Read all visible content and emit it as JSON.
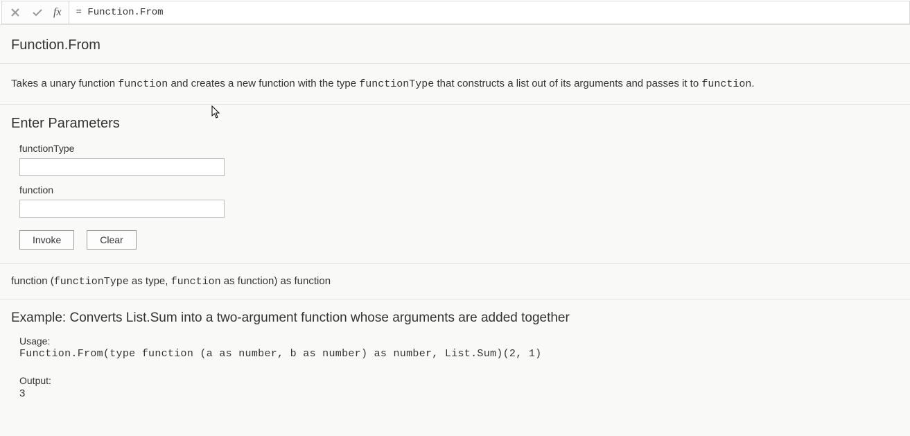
{
  "formulaBar": {
    "fxLabel": "fx",
    "formula": "= Function.From"
  },
  "doc": {
    "title": "Function.From",
    "description_pre": "Takes a unary function ",
    "description_code1": "function",
    "description_mid": " and creates a new function with the type ",
    "description_code2": "functionType",
    "description_post": " that constructs a list out of its arguments and passes it to ",
    "description_code3": "function",
    "description_end": "."
  },
  "params": {
    "heading": "Enter Parameters",
    "items": [
      {
        "label": "functionType",
        "value": ""
      },
      {
        "label": "function",
        "value": ""
      }
    ],
    "invoke": "Invoke",
    "clear": "Clear"
  },
  "signature": {
    "pre": "function (",
    "arg1": "functionType",
    "arg1_type": " as type",
    "sep": ", ",
    "arg2": "function",
    "arg2_type": " as function) as function"
  },
  "example": {
    "heading": "Example: Converts List.Sum into a two-argument function whose arguments are added together",
    "usageLabel": "Usage:",
    "usageCode": "Function.From(type function (a as number, b as number) as number, List.Sum)(2, 1)",
    "outputLabel": "Output:",
    "outputValue": "3"
  }
}
